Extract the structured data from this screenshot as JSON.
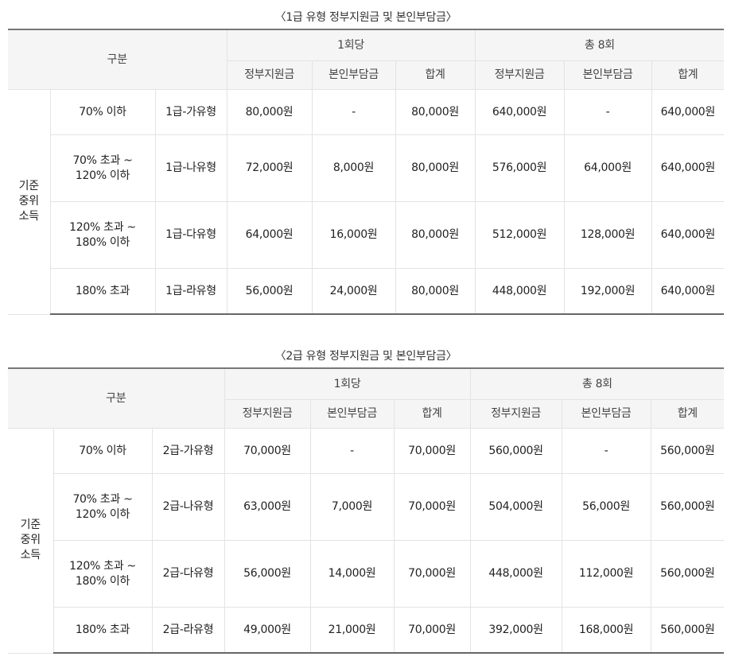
{
  "tables": [
    {
      "caption": "〈1급 유형 정부지원금 및 본인부담금〉",
      "header": {
        "category": "구분",
        "group_per": "1회당",
        "group_total": "총 8회",
        "sub": [
          "정부지원금",
          "본인부담금",
          "합계",
          "정부지원금",
          "본인부담금",
          "합계"
        ]
      },
      "group_label": [
        "기준",
        "중위",
        "소득"
      ],
      "rows": [
        {
          "income": [
            "70% 이하"
          ],
          "type": "1급-가유형",
          "values": [
            "80,000원",
            "-",
            "80,000원",
            "640,000원",
            "-",
            "640,000원"
          ]
        },
        {
          "income": [
            "70% 초과 ~",
            "120% 이하"
          ],
          "type": "1급-나유형",
          "values": [
            "72,000원",
            "8,000원",
            "80,000원",
            "576,000원",
            "64,000원",
            "640,000원"
          ]
        },
        {
          "income": [
            "120% 초과 ~",
            "180% 이하"
          ],
          "type": "1급-다유형",
          "values": [
            "64,000원",
            "16,000원",
            "80,000원",
            "512,000원",
            "128,000원",
            "640,000원"
          ]
        },
        {
          "income": [
            "180% 초과"
          ],
          "type": "1급-라유형",
          "values": [
            "56,000원",
            "24,000원",
            "80,000원",
            "448,000원",
            "192,000원",
            "640,000원"
          ]
        }
      ]
    },
    {
      "caption": "〈2급 유형 정부지원금 및 본인부담금〉",
      "header": {
        "category": "구분",
        "group_per": "1회당",
        "group_total": "총 8회",
        "sub": [
          "정부지원금",
          "본인부담금",
          "합계",
          "정부지원금",
          "본인부담금",
          "합계"
        ]
      },
      "group_label": [
        "기준",
        "중위",
        "소득"
      ],
      "rows": [
        {
          "income": [
            "70% 이하"
          ],
          "type": "2급-가유형",
          "values": [
            "70,000원",
            "-",
            "70,000원",
            "560,000원",
            "-",
            "560,000원"
          ]
        },
        {
          "income": [
            "70% 초과 ~",
            "120% 이하"
          ],
          "type": "2급-나유형",
          "values": [
            "63,000원",
            "7,000원",
            "70,000원",
            "504,000원",
            "56,000원",
            "560,000원"
          ]
        },
        {
          "income": [
            "120% 초과 ~",
            "180% 이하"
          ],
          "type": "2급-다유형",
          "values": [
            "56,000원",
            "14,000원",
            "70,000원",
            "448,000원",
            "112,000원",
            "560,000원"
          ]
        },
        {
          "income": [
            "180% 초과"
          ],
          "type": "2급-라유형",
          "values": [
            "49,000원",
            "21,000원",
            "70,000원",
            "392,000원",
            "168,000원",
            "560,000원"
          ]
        }
      ]
    }
  ]
}
